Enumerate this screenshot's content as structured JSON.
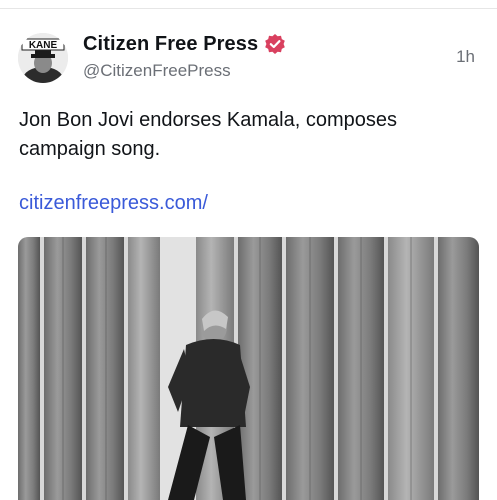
{
  "post": {
    "author": {
      "display_name": "Citizen Free Press",
      "handle": "@CitizenFreePress",
      "avatar_text": "KANE",
      "verified": true
    },
    "timestamp": "1h",
    "text": "Jon Bon Jovi endorses Kamala, composes campaign song.",
    "link": "citizenfreepress.com/",
    "media": {
      "kind": "video-still",
      "description_icon": "image"
    }
  },
  "colors": {
    "link": "#3a5ad9",
    "verified_badge": "#d9405f",
    "secondary_text": "#6b6f76"
  }
}
